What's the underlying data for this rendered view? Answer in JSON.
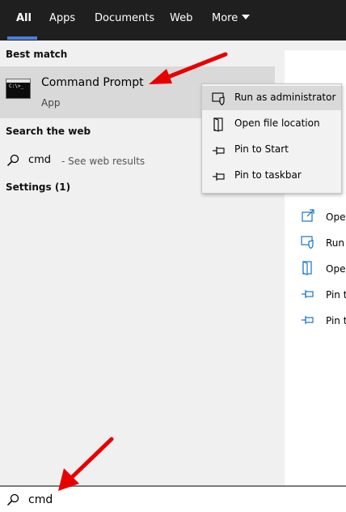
{
  "tabs": [
    {
      "label": "All",
      "active": true
    },
    {
      "label": "Apps"
    },
    {
      "label": "Documents"
    },
    {
      "label": "Web"
    },
    {
      "label": "More"
    }
  ],
  "results": {
    "best_match_header": "Best match",
    "best_match": {
      "title": "Command Prompt",
      "subtitle": "App",
      "icon": "command-prompt-icon"
    },
    "search_web_header": "Search the web",
    "web_result": {
      "query": "cmd",
      "suffix": " - See web results",
      "icon": "search-icon"
    },
    "settings_header": "Settings (1)"
  },
  "context_menu": {
    "items": [
      {
        "label": "Run as administrator",
        "icon": "shield-icon",
        "highlighted": true
      },
      {
        "label": "Open file location",
        "icon": "folder-location-icon"
      },
      {
        "label": "Pin to Start",
        "icon": "pin-icon"
      },
      {
        "label": "Pin to taskbar",
        "icon": "pin-icon"
      }
    ]
  },
  "preview_actions": [
    {
      "label": "Ope",
      "icon": "open-icon"
    },
    {
      "label": "Run",
      "icon": "shield-icon"
    },
    {
      "label": "Ope",
      "icon": "folder-location-icon"
    },
    {
      "label": "Pin t",
      "icon": "pin-icon"
    },
    {
      "label": "Pin t",
      "icon": "pin-icon"
    }
  ],
  "search_box": {
    "query": "cmd",
    "icon": "search-icon"
  },
  "colors": {
    "tabbar_bg": "#1f1f1f",
    "accent": "#4c7fd9",
    "annotation": "#e60000",
    "preview_icon": "#1a73c9"
  }
}
